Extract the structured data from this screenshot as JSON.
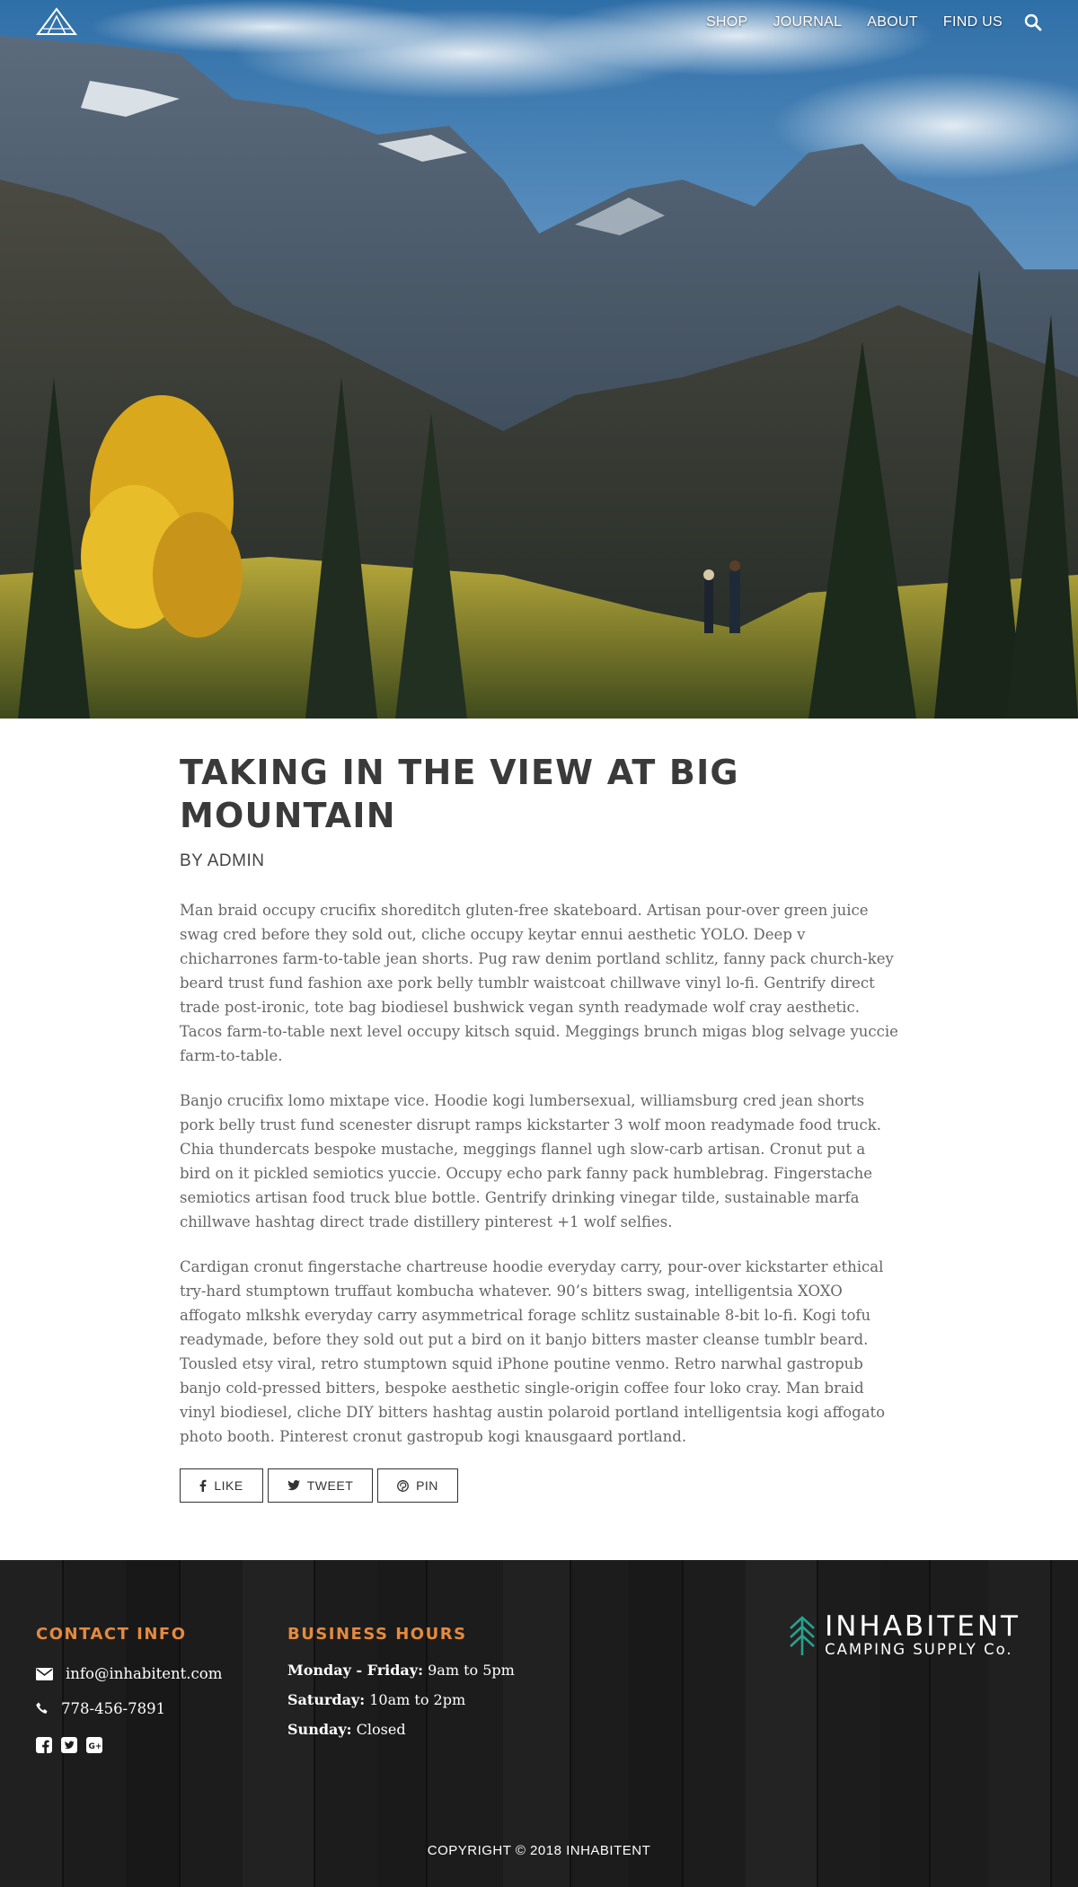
{
  "nav": {
    "links": [
      "SHOP",
      "JOURNAL",
      "ABOUT",
      "FIND US"
    ],
    "search_icon": "search-icon",
    "logo_icon": "tent-logo-icon"
  },
  "hero": {
    "image": "mountain-landscape-with-two-hikers"
  },
  "article": {
    "title": "TAKING IN THE VIEW AT BIG MOUNTAIN",
    "byline": "BY ADMIN",
    "paragraphs": [
      "Man braid occupy crucifix shoreditch gluten-free skateboard. Artisan pour-over green juice swag cred before they sold out, cliche occupy keytar ennui aesthetic YOLO. Deep v chicharrones farm-to-table jean shorts. Pug raw denim portland schlitz, fanny pack church-key beard trust fund fashion axe pork belly tumblr waistcoat chillwave vinyl lo-fi. Gentrify direct trade post-ironic, tote bag biodiesel bushwick vegan synth readymade wolf cray aesthetic. Tacos farm-to-table next level occupy kitsch squid. Meggings brunch migas blog selvage yuccie farm-to-table.",
      "Banjo crucifix lomo mixtape vice. Hoodie kogi lumbersexual, williamsburg cred jean shorts pork belly trust fund scenester disrupt ramps kickstarter 3 wolf moon readymade food truck. Chia thundercats bespoke mustache, meggings flannel ugh slow-carb artisan. Cronut put a bird on it pickled semiotics yuccie. Occupy echo park fanny pack humblebrag. Fingerstache semiotics artisan food truck blue bottle. Gentrify drinking vinegar tilde, sustainable marfa chillwave hashtag direct trade distillery pinterest +1 wolf selfies.",
      "Cardigan cronut fingerstache chartreuse hoodie everyday carry, pour-over kickstarter ethical try-hard stumptown truffaut kombucha whatever. 90’s bitters swag, intelligentsia XOXO affogato mlkshk everyday carry asymmetrical forage schlitz sustainable 8-bit lo-fi. Kogi tofu readymade, before they sold out put a bird on it banjo bitters master cleanse tumblr beard. Tousled etsy viral, retro stumptown squid iPhone poutine venmo. Retro narwhal gastropub banjo cold-pressed bitters, bespoke aesthetic single-origin coffee four loko cray. Man braid vinyl biodiesel, cliche DIY bitters hashtag austin polaroid portland intelligentsia kogi affogato photo booth. Pinterest cronut gastropub kogi knausgaard portland."
    ],
    "share": {
      "like": "LIKE",
      "tweet": "TWEET",
      "pin": "PIN"
    }
  },
  "footer": {
    "contact": {
      "heading": "CONTACT INFO",
      "email": "info@inhabitent.com",
      "phone": "778-456-7891",
      "social_icons": [
        "facebook-icon",
        "twitter-icon",
        "google-plus-icon"
      ]
    },
    "hours": {
      "heading": "BUSINESS HOURS",
      "rows": [
        {
          "day": "Monday - Friday:",
          "time": "9am to 5pm"
        },
        {
          "day": "Saturday:",
          "time": "10am to 2pm"
        },
        {
          "day": "Sunday:",
          "time": "Closed"
        }
      ]
    },
    "brand": {
      "name": "INHABITENT",
      "sub": "CAMPING SUPPLY Co.",
      "icon": "pine-tree-logo-icon"
    },
    "copyright": "COPYRIGHT © 2018 INHABITENT"
  },
  "colors": {
    "accent_orange": "#e58a3f",
    "brand_teal": "#2aa18f",
    "footer_bg": "#1d1d1d",
    "title_text": "#3a3a3a"
  }
}
